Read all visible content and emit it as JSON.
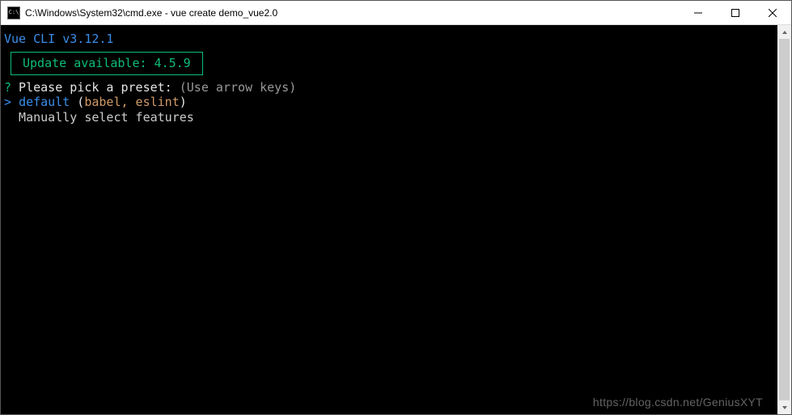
{
  "titlebar": {
    "icon_text": "C:\\",
    "title": "C:\\Windows\\System32\\cmd.exe - vue  create demo_vue2.0"
  },
  "terminal": {
    "cli_header": "Vue CLI v3.12.1",
    "update_box": "Update available: 4.5.9",
    "prompt_mark": "?",
    "prompt_text": " Please pick a preset: ",
    "prompt_hint": "(Use arrow keys)",
    "cursor_arrow": ">",
    "options": [
      {
        "label": "default",
        "detail_open": " (",
        "detail_text": "babel, eslint",
        "detail_close": ")",
        "selected": true
      },
      {
        "label": "Manually select features",
        "selected": false
      }
    ]
  },
  "watermark": "https://blog.csdn.net/GeniusXYT"
}
